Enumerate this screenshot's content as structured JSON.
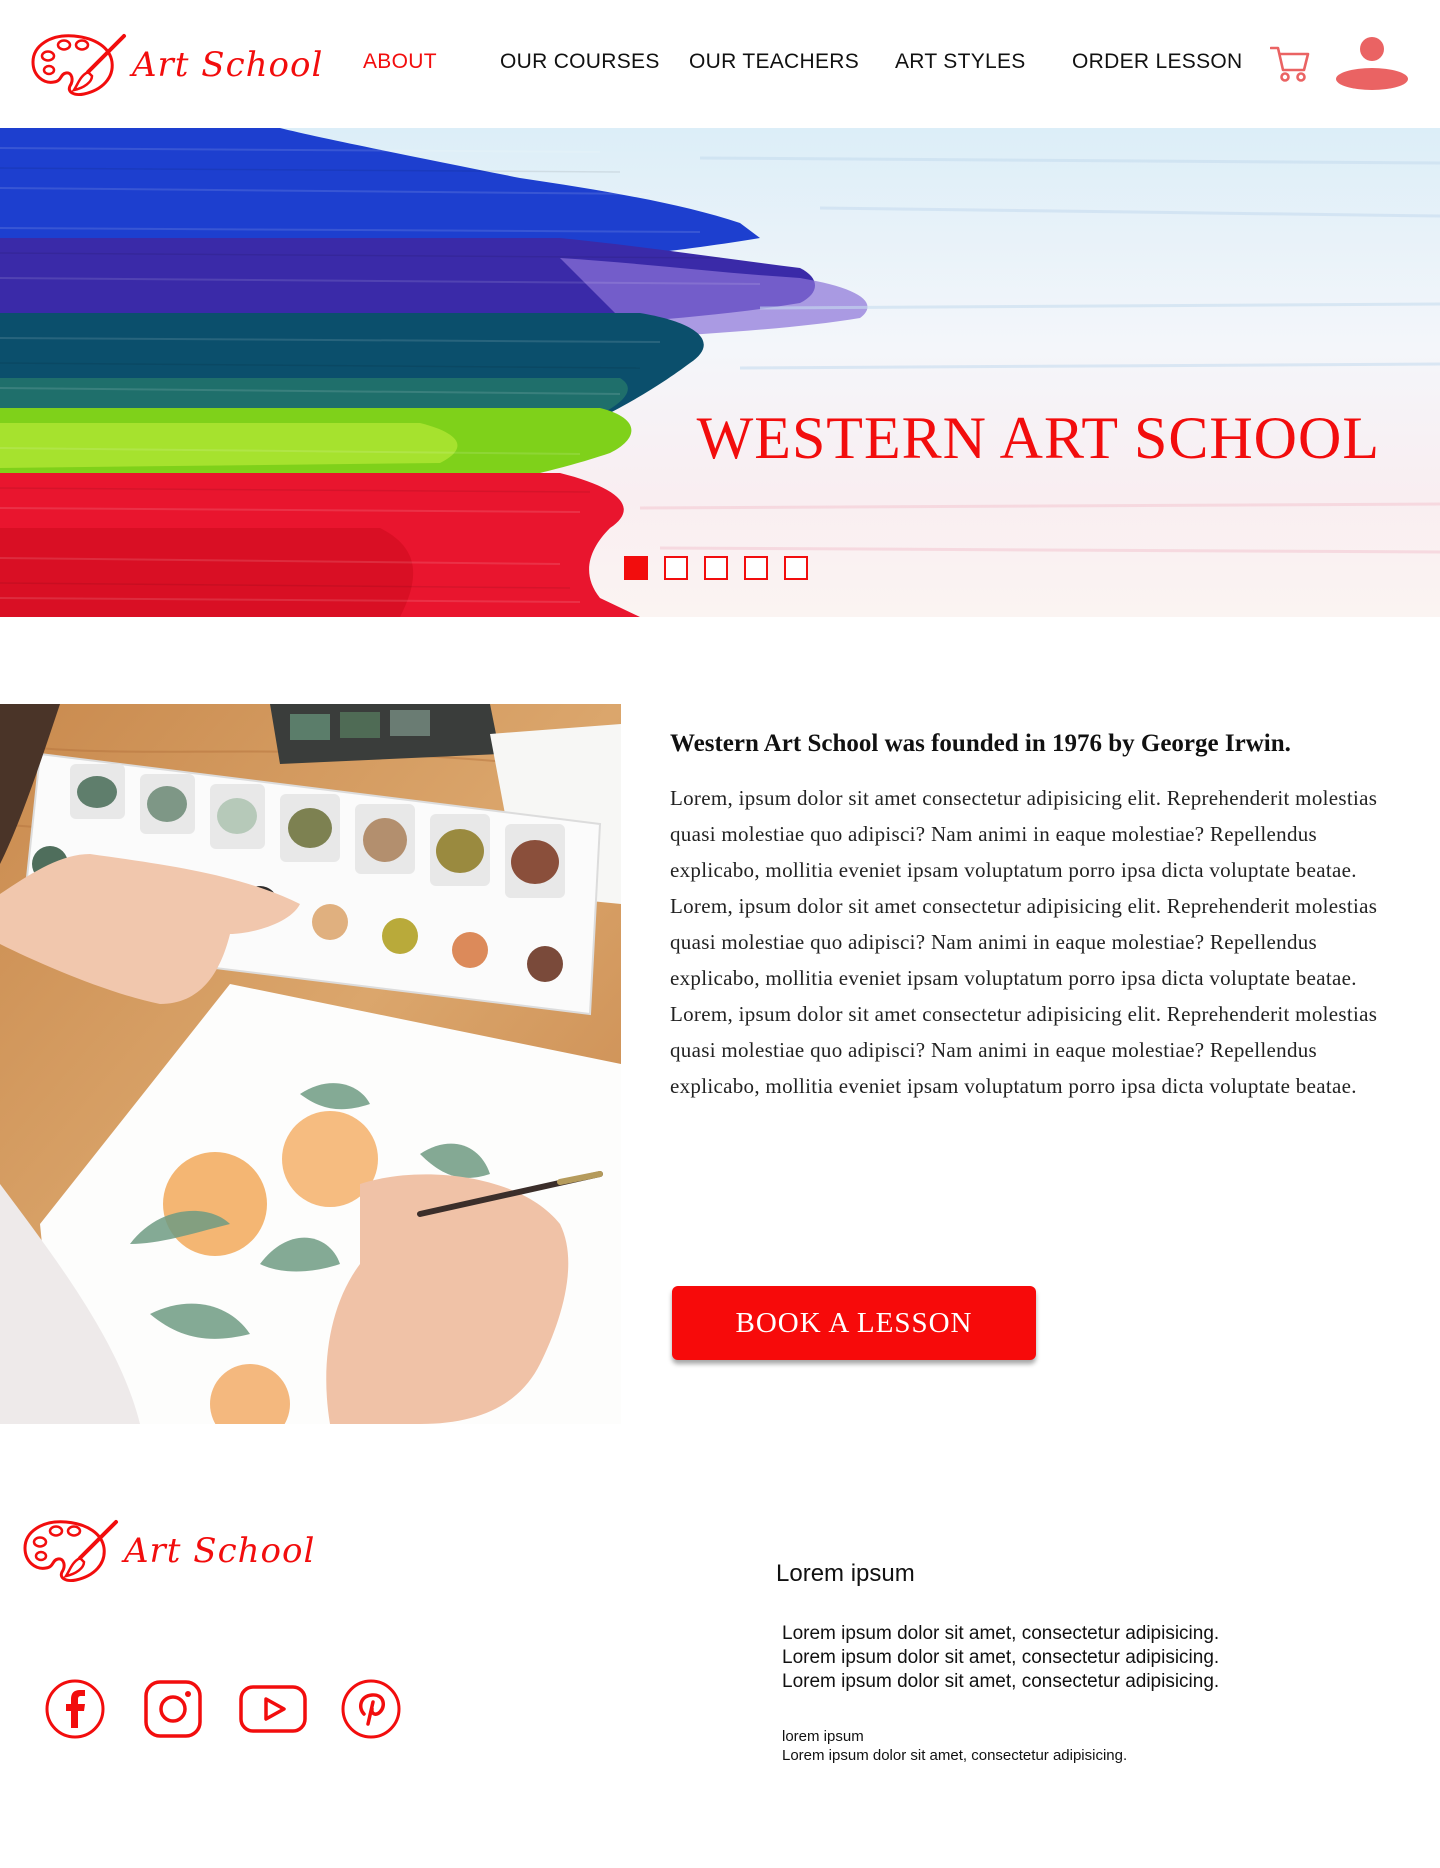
{
  "brand": {
    "name": "Art School",
    "color": "#f20d0d"
  },
  "nav": {
    "items": [
      {
        "label": "ABOUT",
        "active": true
      },
      {
        "label": "OUR COURSES",
        "active": false
      },
      {
        "label": "OUR TEACHERS",
        "active": false
      },
      {
        "label": "ART STYLES",
        "active": false
      },
      {
        "label": "ORDER LESSON",
        "active": false
      }
    ],
    "icons": [
      "cart-icon",
      "user-icon"
    ]
  },
  "hero": {
    "title": "WESTERN ART SCHOOL",
    "slides_total": 5,
    "active_slide": 1
  },
  "about": {
    "heading": "Western Art School was founded in 1976 by George Irwin.",
    "paragraphs": [
      "Lorem, ipsum dolor sit amet consectetur adipisicing elit. Reprehenderit molestias quasi molestiae quo adipisci? Nam animi in eaque molestiae? Repellendus explicabo, mollitia eveniet ipsam voluptatum porro ipsa dicta voluptate beatae.",
      "Lorem, ipsum dolor sit amet consectetur adipisicing elit. Reprehenderit molestias quasi molestiae quo adipisci? Nam animi in eaque molestiae? Repellendus explicabo, mollitia eveniet ipsam voluptatum porro ipsa dicta voluptate beatae.",
      "Lorem, ipsum dolor sit amet consectetur adipisicing elit. Reprehenderit molestias quasi molestiae quo adipisci? Nam animi in eaque molestiae? Repellendus explicabo, mollitia eveniet ipsam voluptatum porro ipsa dicta voluptate beatae."
    ],
    "button_label": "BOOK A LESSON"
  },
  "footer": {
    "brand": "Art School",
    "social_icons": [
      "facebook-icon",
      "instagram-icon",
      "youtube-icon",
      "pinterest-icon"
    ],
    "heading": "Lorem ipsum",
    "lines": [
      "Lorem ipsum dolor sit amet, consectetur adipisicing.",
      "Lorem ipsum dolor sit amet, consectetur adipisicing.",
      "Lorem ipsum dolor sit amet, consectetur adipisicing."
    ],
    "small_title": "lorem ipsum",
    "small_line": "Lorem ipsum dolor sit amet, consectetur adipisicing."
  }
}
